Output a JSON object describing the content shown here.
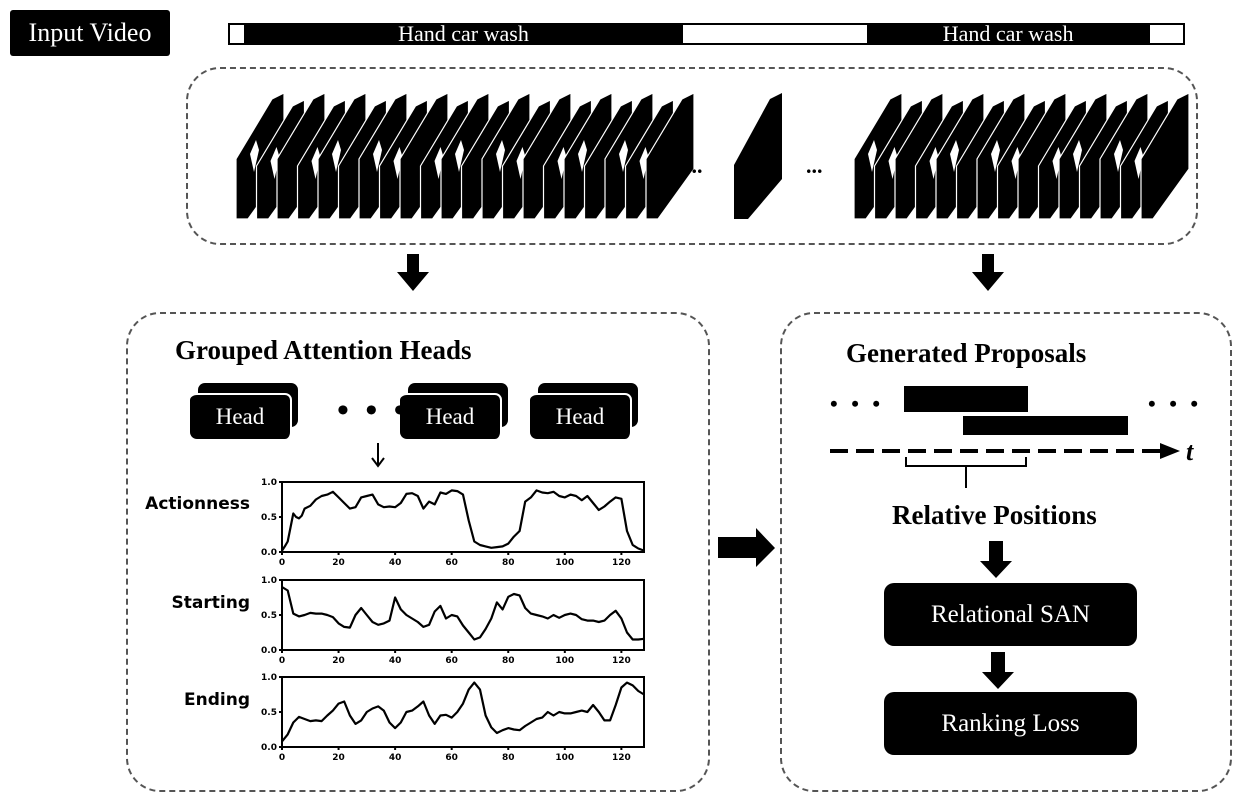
{
  "input_video": {
    "label": "Input Video",
    "timeline_segments": [
      {
        "label": "",
        "type": "background",
        "start_frac": 0.0,
        "end_frac": 0.015
      },
      {
        "label": "Hand car wash",
        "type": "action",
        "start_frac": 0.015,
        "end_frac": 0.475
      },
      {
        "label": "",
        "type": "background",
        "start_frac": 0.475,
        "end_frac": 0.668
      },
      {
        "label": "Hand car wash",
        "type": "action",
        "start_frac": 0.668,
        "end_frac": 0.965
      },
      {
        "label": "",
        "type": "background",
        "start_frac": 0.965,
        "end_frac": 1.0
      }
    ],
    "frame_ellipsis": [
      "...",
      "..."
    ]
  },
  "left_panel": {
    "title": "Grouped Attention Heads",
    "heads": [
      "Head",
      "Head",
      "Head"
    ],
    "heads_ellipsis": "• • •"
  },
  "right_panel": {
    "title": "Generated Proposals",
    "ellipsis_left": "• • •",
    "ellipsis_right": "• • •",
    "axis_label": "t",
    "relative_positions_label": "Relative Positions",
    "steps": [
      "Relational SAN",
      "Ranking Loss"
    ]
  },
  "chart_data": [
    {
      "type": "line",
      "title": "",
      "ylabel": "Actionness",
      "xlabel": "",
      "xlim": [
        0,
        128
      ],
      "ylim": [
        0.0,
        1.0
      ],
      "xticks": [
        "0",
        "20",
        "40",
        "60",
        "80",
        "100",
        "120"
      ],
      "yticks": [
        "0.0",
        "0.5",
        "1.0"
      ],
      "x": [
        0,
        1,
        2,
        3,
        4,
        5,
        6,
        7,
        8,
        10,
        12,
        14,
        16,
        18,
        20,
        22,
        24,
        26,
        28,
        30,
        32,
        34,
        36,
        38,
        40,
        42,
        44,
        46,
        48,
        50,
        52,
        54,
        56,
        58,
        60,
        62,
        64,
        66,
        68,
        70,
        72,
        74,
        76,
        78,
        80,
        82,
        84,
        86,
        88,
        90,
        92,
        94,
        96,
        98,
        100,
        102,
        104,
        106,
        108,
        110,
        112,
        114,
        116,
        118,
        120,
        122,
        124,
        126,
        128
      ],
      "values": [
        0.02,
        0.08,
        0.15,
        0.35,
        0.55,
        0.5,
        0.48,
        0.52,
        0.62,
        0.66,
        0.75,
        0.8,
        0.82,
        0.86,
        0.78,
        0.7,
        0.62,
        0.64,
        0.78,
        0.8,
        0.82,
        0.68,
        0.64,
        0.65,
        0.64,
        0.7,
        0.83,
        0.84,
        0.8,
        0.62,
        0.72,
        0.68,
        0.85,
        0.83,
        0.88,
        0.87,
        0.82,
        0.45,
        0.15,
        0.1,
        0.08,
        0.06,
        0.07,
        0.08,
        0.12,
        0.22,
        0.3,
        0.72,
        0.78,
        0.88,
        0.85,
        0.84,
        0.86,
        0.8,
        0.78,
        0.82,
        0.8,
        0.74,
        0.8,
        0.7,
        0.6,
        0.65,
        0.72,
        0.78,
        0.76,
        0.3,
        0.1,
        0.05,
        0.02
      ]
    },
    {
      "type": "line",
      "title": "",
      "ylabel": "Starting",
      "xlabel": "",
      "xlim": [
        0,
        128
      ],
      "ylim": [
        0.0,
        1.0
      ],
      "xticks": [
        "0",
        "20",
        "40",
        "60",
        "80",
        "100",
        "120"
      ],
      "yticks": [
        "0.0",
        "0.5",
        "1.0"
      ],
      "x": [
        0,
        2,
        4,
        6,
        8,
        10,
        12,
        14,
        16,
        18,
        20,
        22,
        24,
        26,
        28,
        30,
        32,
        34,
        36,
        38,
        40,
        42,
        44,
        46,
        48,
        50,
        52,
        54,
        56,
        58,
        60,
        62,
        64,
        66,
        68,
        70,
        72,
        74,
        76,
        78,
        80,
        82,
        84,
        86,
        88,
        90,
        92,
        94,
        96,
        98,
        100,
        102,
        104,
        106,
        108,
        110,
        112,
        114,
        116,
        118,
        120,
        122,
        124,
        126,
        128
      ],
      "values": [
        0.9,
        0.85,
        0.52,
        0.48,
        0.5,
        0.53,
        0.52,
        0.52,
        0.5,
        0.47,
        0.38,
        0.33,
        0.32,
        0.5,
        0.6,
        0.5,
        0.4,
        0.36,
        0.38,
        0.42,
        0.75,
        0.58,
        0.5,
        0.45,
        0.4,
        0.33,
        0.36,
        0.55,
        0.63,
        0.45,
        0.5,
        0.48,
        0.35,
        0.25,
        0.15,
        0.18,
        0.3,
        0.45,
        0.68,
        0.58,
        0.76,
        0.8,
        0.78,
        0.6,
        0.52,
        0.5,
        0.48,
        0.45,
        0.5,
        0.46,
        0.5,
        0.52,
        0.5,
        0.44,
        0.42,
        0.42,
        0.4,
        0.42,
        0.5,
        0.56,
        0.45,
        0.25,
        0.15,
        0.15,
        0.16
      ]
    },
    {
      "type": "line",
      "title": "",
      "ylabel": "Ending",
      "xlabel": "",
      "xlim": [
        0,
        128
      ],
      "ylim": [
        0.0,
        1.0
      ],
      "xticks": [
        "0",
        "20",
        "40",
        "60",
        "80",
        "100",
        "120"
      ],
      "yticks": [
        "0.0",
        "0.5",
        "1.0"
      ],
      "x": [
        0,
        2,
        4,
        6,
        8,
        10,
        12,
        14,
        16,
        18,
        20,
        22,
        24,
        26,
        28,
        30,
        32,
        34,
        36,
        38,
        40,
        42,
        44,
        46,
        48,
        50,
        52,
        54,
        56,
        58,
        60,
        62,
        64,
        66,
        68,
        70,
        72,
        74,
        76,
        78,
        80,
        82,
        84,
        86,
        88,
        90,
        92,
        94,
        96,
        98,
        100,
        102,
        104,
        106,
        108,
        110,
        112,
        114,
        116,
        118,
        120,
        122,
        124,
        126,
        128
      ],
      "values": [
        0.08,
        0.18,
        0.35,
        0.43,
        0.4,
        0.37,
        0.38,
        0.37,
        0.45,
        0.52,
        0.62,
        0.65,
        0.45,
        0.33,
        0.38,
        0.5,
        0.55,
        0.58,
        0.52,
        0.35,
        0.27,
        0.35,
        0.5,
        0.52,
        0.58,
        0.65,
        0.45,
        0.33,
        0.45,
        0.46,
        0.42,
        0.5,
        0.62,
        0.82,
        0.92,
        0.82,
        0.45,
        0.28,
        0.2,
        0.24,
        0.27,
        0.25,
        0.24,
        0.3,
        0.35,
        0.4,
        0.42,
        0.5,
        0.45,
        0.5,
        0.48,
        0.48,
        0.5,
        0.52,
        0.5,
        0.6,
        0.5,
        0.38,
        0.38,
        0.6,
        0.85,
        0.92,
        0.88,
        0.8,
        0.75
      ]
    }
  ]
}
